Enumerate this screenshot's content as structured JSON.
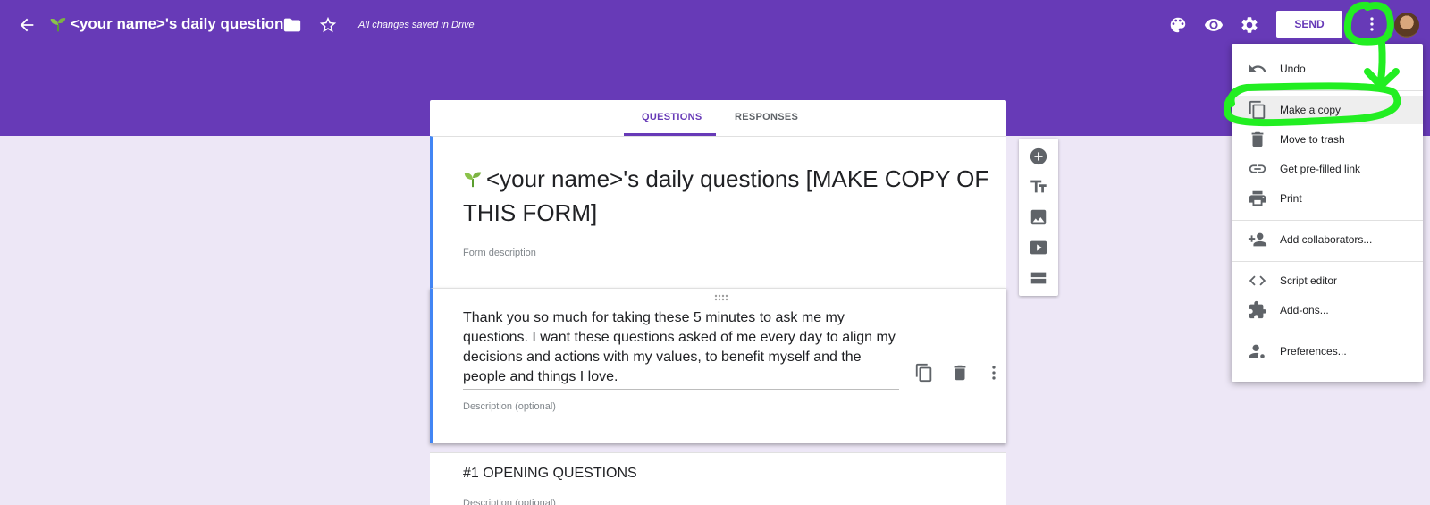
{
  "header": {
    "form_name": "<your name>'s daily questions",
    "save_status": "All changes saved in Drive",
    "send_label": "SEND",
    "colors": {
      "brand": "#673ab7",
      "background": "#ede7f6",
      "annotation": "#22ee22"
    }
  },
  "tabs": [
    {
      "label": "QUESTIONS",
      "active": true
    },
    {
      "label": "RESPONSES",
      "active": false
    }
  ],
  "form": {
    "title": "<your name>'s daily questions [MAKE COPY OF THIS FORM]",
    "description_placeholder": "Form description",
    "text_item": {
      "text": "Thank you so much for taking these 5 minutes to ask me my questions. I want these questions asked of me every day to align my decisions and actions with my values, to benefit myself and the people and things I love.",
      "description_placeholder": "Description (optional)"
    },
    "section": {
      "title": "#1 OPENING QUESTIONS",
      "description_placeholder": "Description (optional)"
    }
  },
  "toolbar_icons": [
    "add-question-icon",
    "add-title-icon",
    "add-image-icon",
    "add-video-icon",
    "add-section-icon"
  ],
  "menu": {
    "items": [
      {
        "label": "Undo",
        "icon": "undo-icon"
      },
      {
        "label": "Make a copy",
        "icon": "copy-icon",
        "highlighted": true
      },
      {
        "label": "Move to trash",
        "icon": "trash-icon"
      },
      {
        "label": "Get pre-filled link",
        "icon": "link-icon"
      },
      {
        "label": "Print",
        "icon": "print-icon"
      },
      {
        "label": "Add collaborators...",
        "icon": "add-people-icon"
      },
      {
        "label": "Script editor",
        "icon": "code-icon"
      },
      {
        "label": "Add-ons...",
        "icon": "puzzle-icon"
      },
      {
        "label": "Preferences...",
        "icon": "person-settings-icon"
      }
    ]
  }
}
